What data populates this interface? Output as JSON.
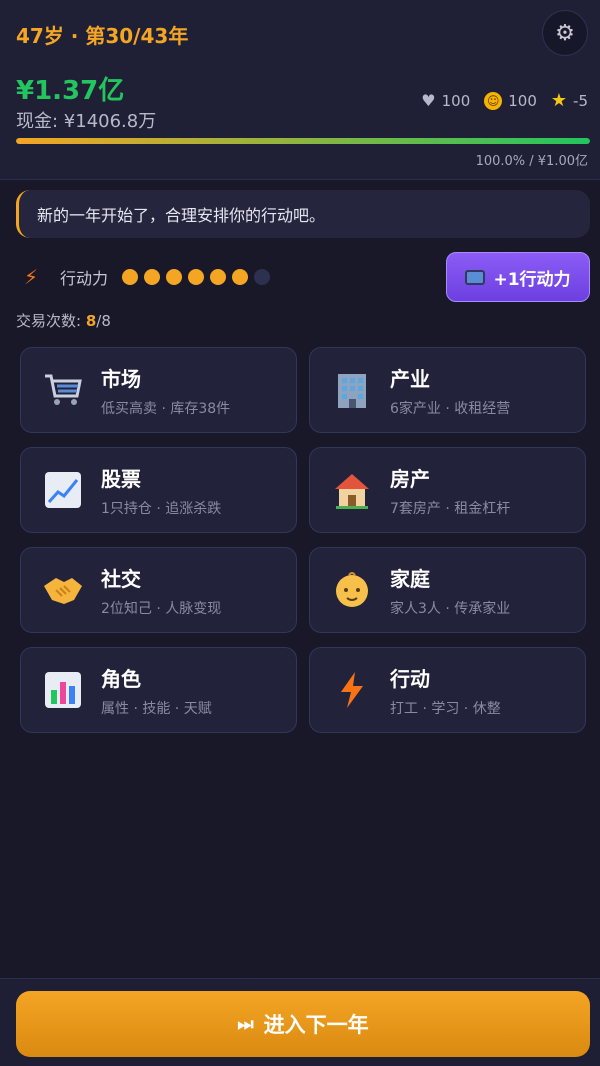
{
  "header": {
    "age_line": "47岁 · 第30/43年",
    "net_worth": "¥1.37亿",
    "cash": "现金: ¥1406.8万",
    "stats": {
      "health": "100",
      "happiness": "100",
      "reputation": "-5"
    },
    "progress_fraction": 1.0,
    "progress_label": "100.0% / ¥1.00亿"
  },
  "message": "新的一年开始了，合理安排你的行动吧。",
  "energy": {
    "label": "行动力",
    "filled": 6,
    "total": 7,
    "button_label": "+1行动力"
  },
  "trades": {
    "label": "交易次数: ",
    "used": "8",
    "max": "/8"
  },
  "cards": [
    {
      "title": "市场",
      "sub": "低买高卖 · 库存38件",
      "icon": "shopping-cart-icon"
    },
    {
      "title": "产业",
      "sub": "6家产业 · 收租经营",
      "icon": "office-building-icon"
    },
    {
      "title": "股票",
      "sub": "1只持仓 · 追涨杀跌",
      "icon": "chart-increasing-icon"
    },
    {
      "title": "房产",
      "sub": "7套房产 · 租金杠杆",
      "icon": "house-icon"
    },
    {
      "title": "社交",
      "sub": "2位知己 · 人脉变现",
      "icon": "handshake-icon"
    },
    {
      "title": "家庭",
      "sub": "家人3人 · 传承家业",
      "icon": "baby-icon"
    },
    {
      "title": "角色",
      "sub": "属性 · 技能 · 天赋",
      "icon": "bar-chart-icon"
    },
    {
      "title": "行动",
      "sub": "打工 · 学习 · 休整",
      "icon": "lightning-icon"
    }
  ],
  "footer": {
    "next_label": "进入下一年"
  },
  "colors": {
    "accent": "#f5a524",
    "networth": "#22c55e",
    "purple": "#7c4dff",
    "background": "#181829"
  }
}
